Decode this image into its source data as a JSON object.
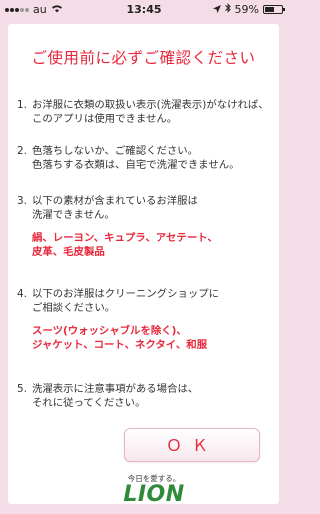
{
  "status_bar": {
    "carrier": "au",
    "time": "13:45",
    "battery_percent": "59%",
    "battery_level": 0.59,
    "icons": [
      "signal-dots",
      "wifi-icon",
      "location-arrow-icon",
      "bluetooth-icon",
      "battery-icon"
    ]
  },
  "dialog": {
    "title": "ご使用前に必ずご確認ください",
    "items": [
      {
        "num": "1.",
        "lines": [
          "お洋服に衣類の取扱い表示(洗濯表示)がなければ、",
          "このアプリは使用できません。"
        ],
        "highlights": []
      },
      {
        "num": "2.",
        "lines": [
          "色落ちしないか、ご確認ください。",
          "色落ちする衣類は、自宅で洗濯できません。"
        ],
        "highlights": []
      },
      {
        "num": "3.",
        "lines": [
          "以下の素材が含まれているお洋服は",
          "洗濯できません。"
        ],
        "highlights": [
          "絹、レーヨン、キュプラ、アセテート、",
          "皮革、毛皮製品"
        ]
      },
      {
        "num": "4.",
        "lines": [
          "以下のお洋服はクリーニングショップに",
          "ご相談ください。"
        ],
        "highlights": [
          "スーツ(ウォッシャブルを除く)、",
          "ジャケット、コート、ネクタイ、和服"
        ]
      },
      {
        "num": "5.",
        "lines": [
          "洗濯表示に注意事項がある場合は、",
          "それに従ってください。"
        ],
        "highlights": []
      }
    ],
    "ok_label": "ＯＫ"
  },
  "logo": {
    "tagline": "今日を愛する。",
    "brand": "LION"
  },
  "colors": {
    "accent_red": "#e8283c",
    "background_pink": "#f5dde8",
    "brand_green": "#2f8a3a"
  }
}
